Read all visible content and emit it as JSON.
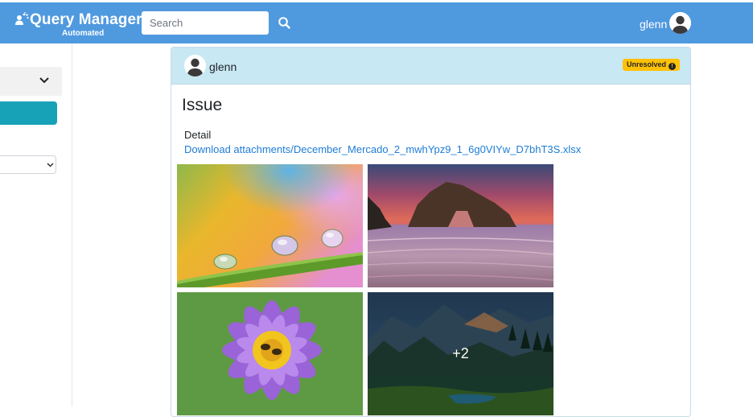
{
  "app": {
    "brand_title": "Query Manager",
    "brand_subtitle": "Automated"
  },
  "search": {
    "placeholder": "Search",
    "value": ""
  },
  "user": {
    "name": "glenn"
  },
  "issue": {
    "author": "glenn",
    "status": "Unresolved",
    "title": "Issue",
    "detail_label": "Detail",
    "download_link": "Download attachments/December_Mercado_2_mwhYpz9_1_6g0VIYw_D7bhT3S.xlsx",
    "images": [
      {
        "subject": "water droplets on plant stem"
      },
      {
        "subject": "sea rock at sunset"
      },
      {
        "subject": "purple water lily with bee"
      },
      {
        "subject": "mountain lake forest"
      }
    ],
    "more_images_label": "+2"
  },
  "colors": {
    "nav": "#4f99df",
    "card_header": "#c8e8f3",
    "badge": "#ffc107",
    "link": "#1e7dd6",
    "teal_button": "#17a2b8"
  },
  "icons": [
    "users-icon",
    "search-icon",
    "avatar-icon",
    "chevron-down-icon",
    "info-icon"
  ]
}
